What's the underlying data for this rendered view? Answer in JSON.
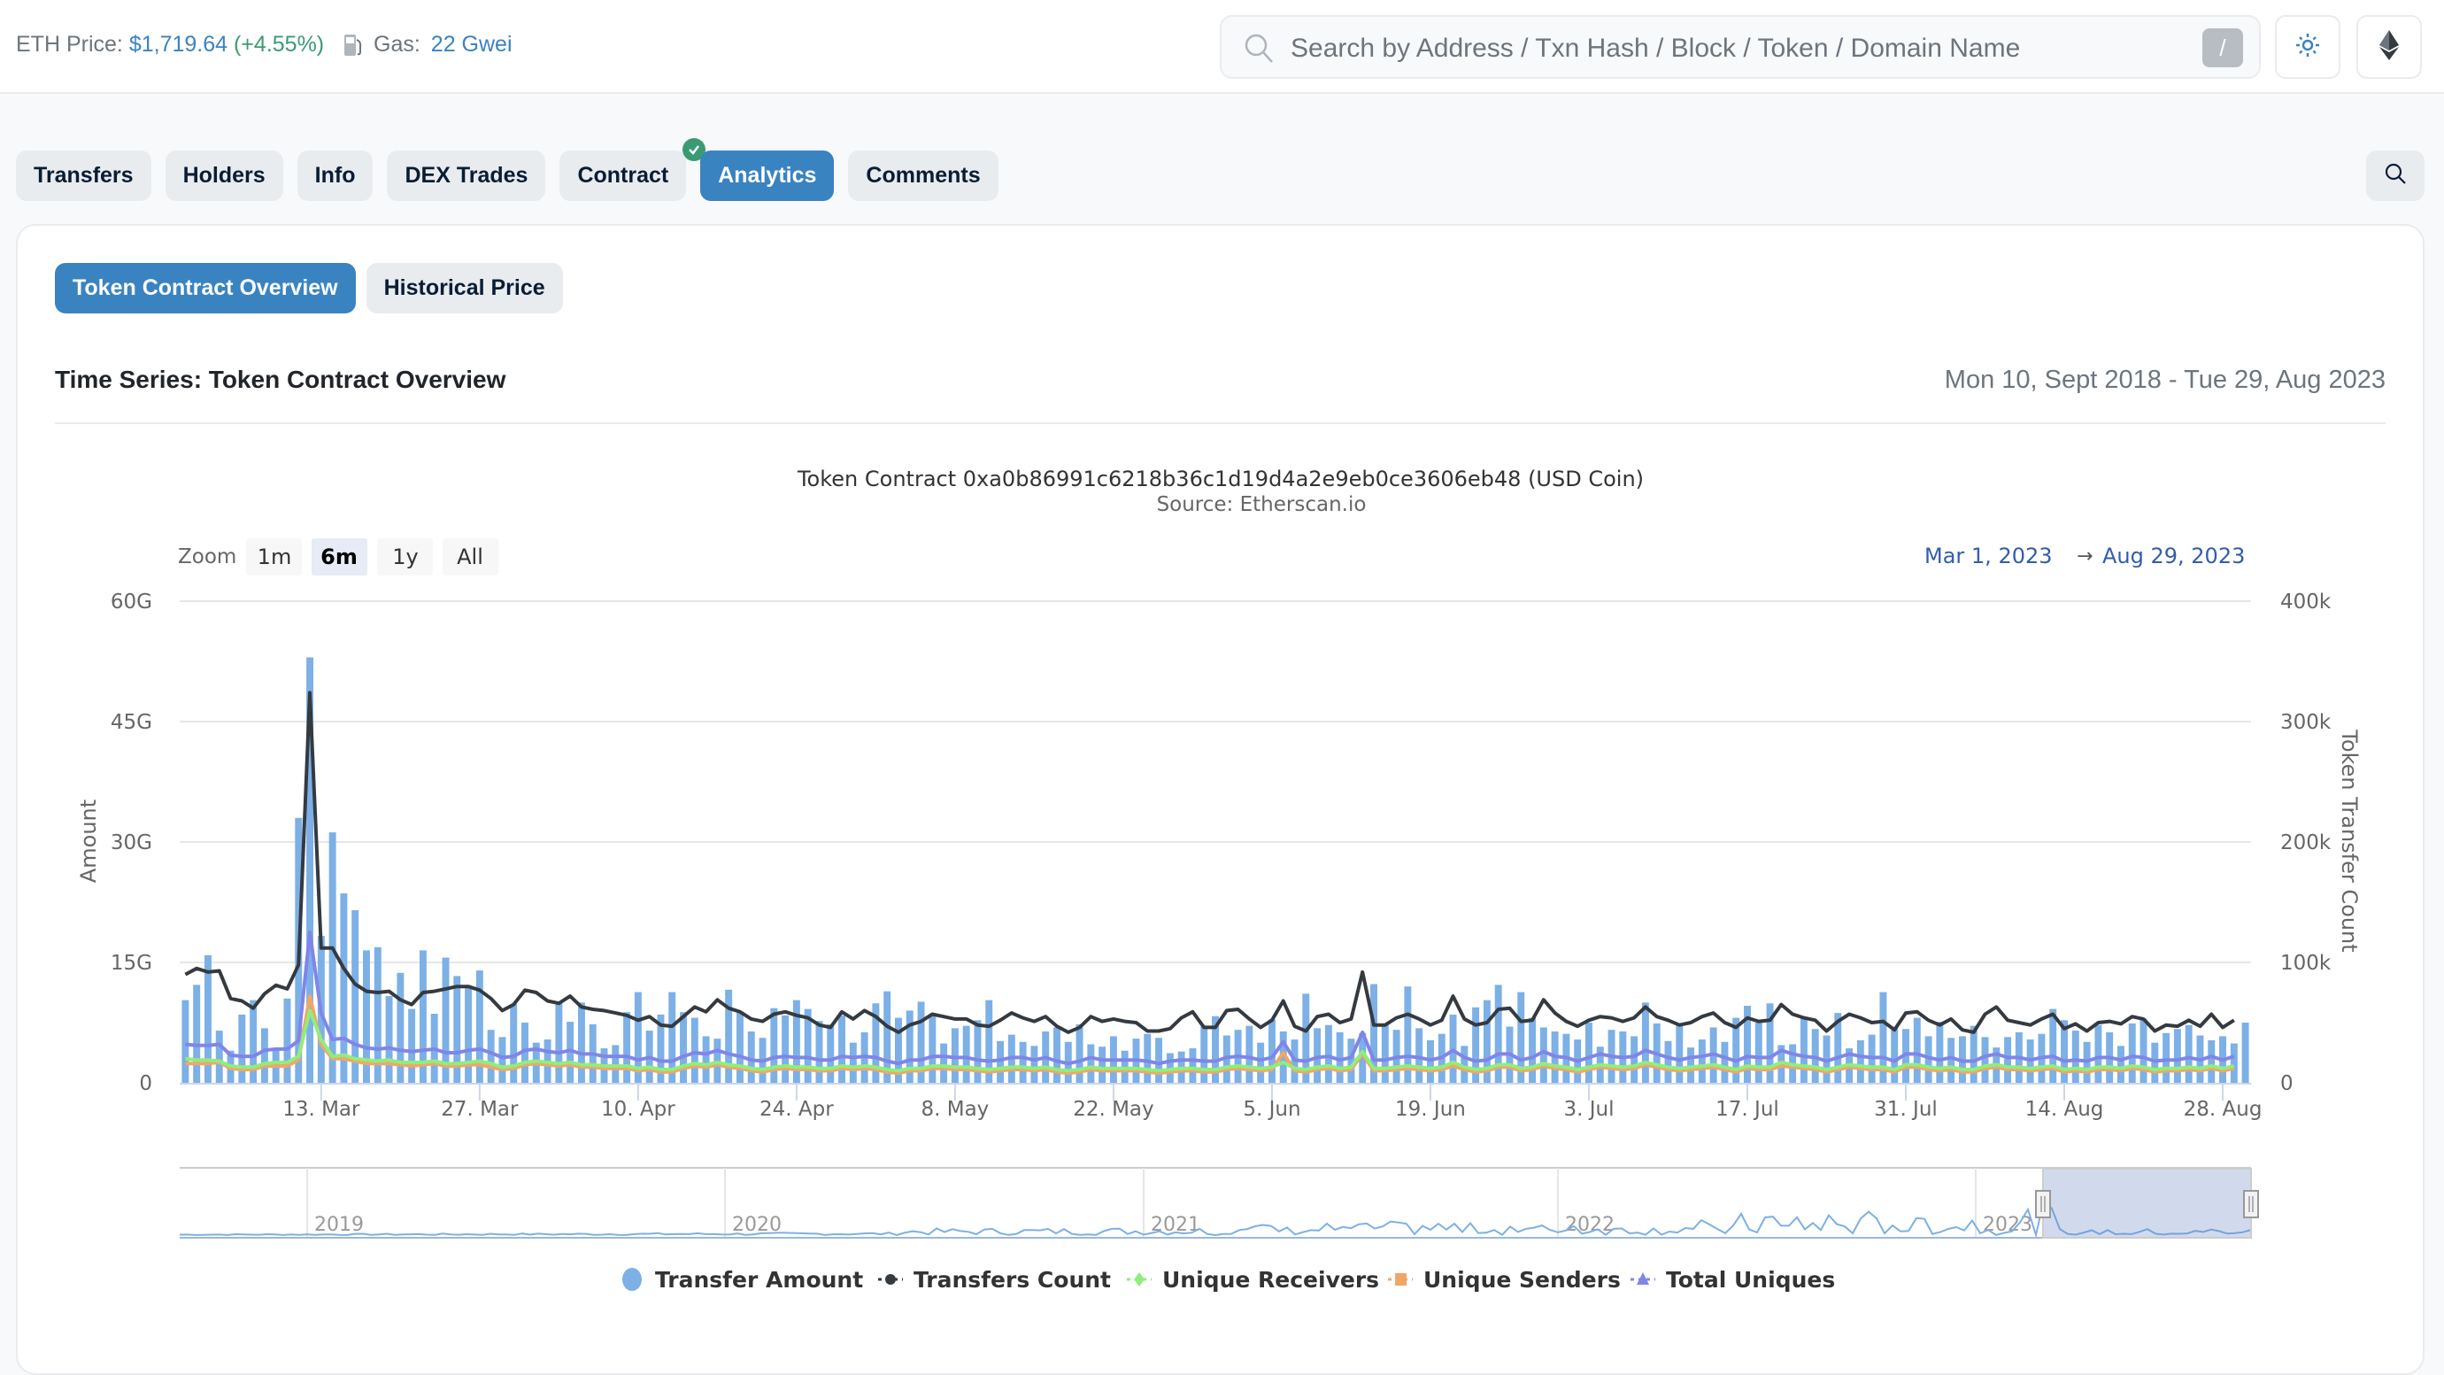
{
  "header": {
    "eth_price_label": "ETH Price:",
    "eth_price_value": "$1,719.64",
    "eth_price_change": "(+4.55%)",
    "gas_label": "Gas:",
    "gas_value": "22 Gwei",
    "search_placeholder": "Search by Address / Txn Hash / Block / Token / Domain Name",
    "search_shortcut": "/",
    "theme_icon": "sun-icon",
    "network_icon": "ethereum-icon"
  },
  "tabs": [
    {
      "label": "Transfers",
      "active": false
    },
    {
      "label": "Holders",
      "active": false
    },
    {
      "label": "Info",
      "active": false
    },
    {
      "label": "DEX Trades",
      "active": false
    },
    {
      "label": "Contract",
      "active": false,
      "verified": true
    },
    {
      "label": "Analytics",
      "active": true
    },
    {
      "label": "Comments",
      "active": false
    }
  ],
  "subtabs": [
    {
      "label": "Token Contract Overview",
      "active": true
    },
    {
      "label": "Historical Price",
      "active": false
    }
  ],
  "section": {
    "title": "Time Series: Token Contract Overview",
    "date_range": "Mon 10, Sept 2018 - Tue 29, Aug 2023"
  },
  "range_selector": {
    "zoom_label": "Zoom",
    "buttons": [
      "1m",
      "6m",
      "1y",
      "All"
    ],
    "selected": "6m",
    "from": "Mar 1, 2023",
    "arrow": "→",
    "to": "Aug 29, 2023"
  },
  "colors": {
    "accent": "#3a83c1",
    "transfer_amount": "#7cb0e6",
    "transfers_count": "#343a40",
    "unique_receivers": "#90ed7d",
    "unique_senders": "#f0a766",
    "total_uniques": "#8085e9",
    "verified": "#3a9b72"
  },
  "chart_data": {
    "type": "bar",
    "title": "Token Contract 0xa0b86991c6218b36c1d19d4a2e9eb0ce3606eb48 (USD Coin)",
    "subtitle": "Source: Etherscan.io",
    "x_start": "2023-03-01",
    "x_end": "2023-08-29",
    "x_tick_labels": [
      "13. Mar",
      "27. Mar",
      "10. Apr",
      "24. Apr",
      "8. May",
      "22. May",
      "5. Jun",
      "19. Jun",
      "3. Jul",
      "17. Jul",
      "31. Jul",
      "14. Aug",
      "28. Aug"
    ],
    "x_tick_day_index": [
      12,
      26,
      40,
      54,
      68,
      82,
      96,
      110,
      124,
      138,
      152,
      166,
      180
    ],
    "y_left": {
      "label": "Amount",
      "ticks": [
        "0",
        "15G",
        "30G",
        "45G",
        "60G"
      ],
      "range": [
        0,
        60
      ],
      "unit": "G"
    },
    "y_right": {
      "label": "Token Transfer Count",
      "ticks": [
        "0",
        "100k",
        "200k",
        "300k",
        "400k"
      ],
      "range": [
        0,
        400
      ],
      "unit": "k"
    },
    "grid": true,
    "legend_position": "bottom",
    "series": [
      {
        "name": "Transfer Amount",
        "type": "column",
        "axis": "left",
        "values": [
          10.3,
          12.2,
          15.9,
          6.5,
          4.0,
          8.5,
          10.3,
          6.8,
          4.2,
          10.5,
          33.0,
          53.0,
          18.3,
          31.2,
          23.6,
          21.5,
          16.5,
          16.9,
          10.8,
          13.7,
          9.2,
          16.5,
          8.6,
          15.6,
          13.3,
          11.9,
          14.0,
          6.6,
          5.7,
          9.8,
          7.5,
          5.0,
          5.4,
          10.1,
          7.6,
          10.0,
          7.3,
          4.3,
          4.7,
          8.8,
          11.3,
          6.5,
          8.5,
          11.3,
          8.8,
          8.1,
          5.8,
          5.5,
          11.6,
          8.7,
          6.4,
          5.6,
          9.3,
          8.4,
          10.3,
          9.2,
          7.7,
          7.3,
          8.4,
          5.0,
          6.3,
          9.9,
          11.4,
          8.1,
          9.0,
          10.1,
          8.6,
          4.9,
          6.8,
          7.1,
          7.8,
          10.3,
          5.2,
          6.0,
          5.1,
          4.6,
          6.4,
          6.9,
          5.1,
          7.3,
          4.8,
          4.5,
          5.8,
          4.0,
          5.5,
          6.1,
          5.6,
          3.7,
          3.9,
          4.3,
          7.0,
          8.3,
          5.9,
          6.6,
          7.1,
          5.0,
          7.9,
          6.4,
          5.4,
          11.1,
          6.8,
          7.2,
          6.3,
          5.5,
          6.2,
          12.3,
          7.3,
          6.6,
          12.0,
          6.8,
          5.3,
          6.1,
          8.5,
          4.6,
          9.4,
          10.3,
          12.2,
          7.0,
          11.3,
          8.1,
          6.9,
          6.4,
          6.1,
          5.4,
          7.5,
          4.5,
          6.6,
          6.4,
          5.8,
          10.0,
          7.4,
          5.2,
          7.2,
          4.4,
          5.4,
          6.9,
          5.1,
          8.1,
          9.6,
          7.5,
          9.9,
          4.7,
          4.8,
          8.2,
          6.7,
          5.9,
          8.7,
          4.3,
          5.3,
          6.0,
          11.3,
          7.0,
          6.7,
          8.1,
          5.8,
          7.6,
          5.6,
          5.8,
          7.1,
          5.7,
          4.4,
          5.7,
          6.3,
          5.4,
          6.1,
          9.2,
          7.8,
          6.5,
          5.1,
          7.2,
          6.3,
          4.6,
          7.4,
          8.0,
          5.0,
          6.2,
          6.7,
          7.2,
          5.9,
          5.3,
          5.8,
          4.9,
          7.5
        ]
      },
      {
        "name": "Transfers Count",
        "type": "line",
        "axis": "right",
        "values": [
          90,
          95,
          92,
          93,
          70,
          68,
          62,
          74,
          81,
          78,
          98,
          324,
          112,
          112,
          95,
          82,
          76,
          75,
          76,
          69,
          65,
          75,
          76,
          78,
          80,
          80,
          77,
          70,
          60,
          65,
          77,
          75,
          68,
          66,
          72,
          63,
          61,
          60,
          58,
          56,
          52,
          55,
          48,
          47,
          55,
          63,
          59,
          69,
          62,
          59,
          53,
          51,
          57,
          59,
          56,
          54,
          48,
          46,
          59,
          53,
          60,
          55,
          47,
          42,
          48,
          51,
          57,
          55,
          53,
          53,
          48,
          47,
          52,
          58,
          54,
          51,
          55,
          47,
          42,
          46,
          55,
          51,
          53,
          51,
          50,
          43,
          43,
          45,
          54,
          59,
          46,
          46,
          60,
          61,
          53,
          46,
          52,
          68,
          47,
          43,
          55,
          57,
          50,
          53,
          92,
          48,
          48,
          54,
          57,
          53,
          48,
          52,
          72,
          53,
          48,
          50,
          61,
          62,
          51,
          52,
          69,
          58,
          51,
          47,
          52,
          55,
          54,
          51,
          54,
          63,
          55,
          52,
          48,
          50,
          55,
          58,
          50,
          46,
          54,
          51,
          52,
          65,
          57,
          54,
          52,
          43,
          51,
          57,
          54,
          50,
          51,
          44,
          58,
          59,
          52,
          48,
          53,
          44,
          42,
          57,
          63,
          52,
          50,
          48,
          53,
          57,
          45,
          49,
          43,
          50,
          51,
          49,
          55,
          53,
          43,
          48,
          47,
          52,
          47,
          57,
          46,
          52
        ]
      },
      {
        "name": "Unique Receivers",
        "type": "line",
        "axis": "right",
        "values": [
          20,
          19,
          19,
          18,
          14,
          13,
          13,
          16,
          17,
          17,
          22,
          60,
          36,
          22,
          23,
          20,
          19,
          18,
          19,
          17,
          17,
          17,
          18,
          16,
          16,
          17,
          18,
          16,
          13,
          14,
          17,
          18,
          17,
          16,
          17,
          15,
          15,
          14,
          14,
          14,
          12,
          13,
          11,
          11,
          14,
          16,
          15,
          17,
          15,
          14,
          12,
          11,
          13,
          14,
          13,
          13,
          12,
          12,
          14,
          13,
          14,
          13,
          11,
          10,
          12,
          12,
          14,
          14,
          13,
          13,
          12,
          11,
          12,
          13,
          13,
          12,
          13,
          11,
          10,
          11,
          13,
          12,
          12,
          12,
          12,
          11,
          10,
          11,
          12,
          12,
          11,
          11,
          13,
          14,
          13,
          12,
          13,
          17,
          12,
          11,
          13,
          14,
          12,
          13,
          26,
          12,
          12,
          13,
          14,
          13,
          12,
          13,
          17,
          13,
          11,
          12,
          15,
          15,
          12,
          13,
          16,
          14,
          13,
          11,
          13,
          15,
          14,
          13,
          14,
          17,
          15,
          13,
          12,
          13,
          14,
          15,
          13,
          11,
          14,
          13,
          13,
          17,
          15,
          14,
          13,
          11,
          13,
          15,
          14,
          13,
          13,
          11,
          15,
          15,
          13,
          12,
          13,
          11,
          11,
          14,
          15,
          13,
          13,
          12,
          13,
          14,
          11,
          12,
          11,
          13,
          13,
          12,
          14,
          13,
          11,
          12,
          12,
          13,
          12,
          14,
          12,
          14
        ]
      },
      {
        "name": "Unique Senders",
        "type": "line",
        "axis": "right",
        "values": [
          16,
          16,
          16,
          17,
          12,
          11,
          11,
          14,
          14,
          14,
          19,
          72,
          32,
          20,
          20,
          18,
          16,
          16,
          16,
          15,
          14,
          15,
          16,
          14,
          14,
          15,
          15,
          13,
          11,
          12,
          15,
          16,
          15,
          14,
          15,
          13,
          13,
          12,
          12,
          12,
          10,
          11,
          9,
          9,
          12,
          14,
          13,
          15,
          13,
          12,
          10,
          9,
          11,
          12,
          11,
          11,
          10,
          10,
          12,
          11,
          12,
          11,
          9,
          8,
          10,
          10,
          12,
          12,
          11,
          11,
          10,
          9,
          10,
          11,
          11,
          10,
          11,
          9,
          8,
          9,
          11,
          10,
          10,
          10,
          10,
          9,
          8,
          9,
          10,
          10,
          9,
          9,
          11,
          12,
          11,
          10,
          11,
          25,
          10,
          9,
          11,
          12,
          10,
          11,
          24,
          10,
          10,
          11,
          12,
          11,
          10,
          11,
          14,
          11,
          9,
          10,
          13,
          13,
          10,
          11,
          14,
          12,
          11,
          9,
          11,
          13,
          12,
          11,
          12,
          15,
          13,
          11,
          10,
          11,
          12,
          13,
          11,
          9,
          12,
          11,
          11,
          14,
          13,
          12,
          11,
          9,
          11,
          13,
          12,
          11,
          11,
          9,
          13,
          13,
          11,
          10,
          11,
          9,
          9,
          12,
          13,
          11,
          11,
          10,
          11,
          12,
          9,
          10,
          9,
          11,
          11,
          10,
          12,
          11,
          9,
          10,
          10,
          11,
          10,
          12,
          10,
          12
        ]
      },
      {
        "name": "Total Uniques",
        "type": "line",
        "axis": "right",
        "values": [
          32,
          31,
          31,
          32,
          23,
          22,
          22,
          27,
          28,
          28,
          35,
          125,
          58,
          36,
          37,
          32,
          29,
          28,
          29,
          27,
          26,
          27,
          28,
          25,
          25,
          27,
          28,
          25,
          21,
          22,
          27,
          28,
          26,
          25,
          27,
          24,
          24,
          22,
          22,
          22,
          19,
          21,
          18,
          18,
          22,
          25,
          24,
          27,
          24,
          22,
          19,
          18,
          21,
          22,
          21,
          21,
          19,
          19,
          22,
          21,
          22,
          21,
          18,
          16,
          19,
          19,
          22,
          22,
          21,
          21,
          19,
          18,
          19,
          21,
          21,
          19,
          21,
          18,
          16,
          18,
          21,
          19,
          19,
          19,
          19,
          18,
          16,
          18,
          19,
          19,
          18,
          18,
          21,
          22,
          21,
          19,
          21,
          34,
          19,
          18,
          21,
          22,
          19,
          21,
          42,
          19,
          19,
          21,
          22,
          21,
          19,
          21,
          27,
          21,
          18,
          19,
          24,
          24,
          19,
          21,
          26,
          22,
          21,
          18,
          21,
          24,
          22,
          21,
          22,
          27,
          24,
          21,
          19,
          21,
          22,
          24,
          21,
          18,
          22,
          21,
          21,
          27,
          24,
          22,
          21,
          18,
          21,
          24,
          22,
          21,
          21,
          18,
          24,
          24,
          21,
          19,
          21,
          18,
          18,
          22,
          24,
          21,
          21,
          19,
          21,
          22,
          18,
          19,
          18,
          21,
          21,
          19,
          22,
          21,
          18,
          19,
          19,
          21,
          19,
          22,
          19,
          22
        ]
      }
    ],
    "navigator": {
      "year_labels": [
        "2019",
        "2020",
        "2021",
        "2022",
        "2023"
      ],
      "selected_from": "Mar 1, 2023",
      "selected_to": "Aug 29, 2023"
    }
  }
}
